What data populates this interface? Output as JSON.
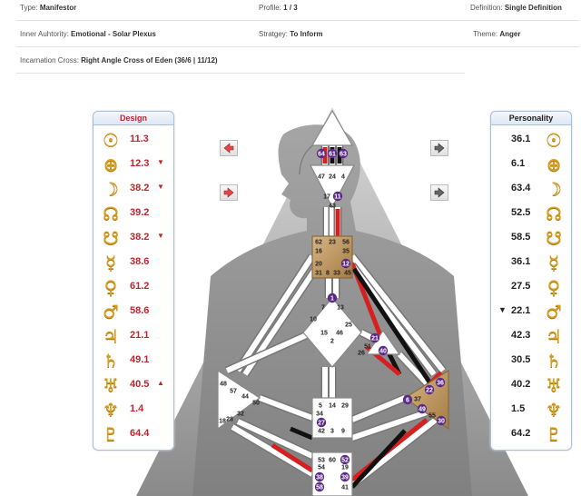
{
  "info": {
    "type_label": "Type:",
    "type_value": "Manifestor",
    "profile_label": "Profile:",
    "profile_value": "1 / 3",
    "definition_label": "Definition:",
    "definition_value": "Single Definition",
    "authority_label": "Inner Auhtority:",
    "authority_value": "Emotional - Solar Plexus",
    "strategy_label": "Stratgey:",
    "strategy_value": "To Inform",
    "theme_label": "Theme:",
    "theme_value": "Anger",
    "cross_label": "Incarnation Cross:",
    "cross_value": "Right Angle Cross of Eden (36/6 | 11/12)"
  },
  "design": {
    "title": "Design",
    "rows": [
      {
        "icon": "sun-icon",
        "glyph": "☉",
        "value": "11.3",
        "mark": ""
      },
      {
        "icon": "earth-icon",
        "glyph": "⊕",
        "value": "12.3",
        "mark": "▼"
      },
      {
        "icon": "moon-icon",
        "glyph": "☽",
        "value": "38.2",
        "mark": "▼"
      },
      {
        "icon": "north-node-icon",
        "glyph": "☊",
        "value": "39.2",
        "mark": ""
      },
      {
        "icon": "south-node-icon",
        "glyph": "☋",
        "value": "38.2",
        "mark": "▼"
      },
      {
        "icon": "mercury-icon",
        "glyph": "☿",
        "value": "38.6",
        "mark": ""
      },
      {
        "icon": "venus-icon",
        "glyph": "♀",
        "value": "61.2",
        "mark": ""
      },
      {
        "icon": "mars-icon",
        "glyph": "♂",
        "value": "58.6",
        "mark": ""
      },
      {
        "icon": "jupiter-icon",
        "glyph": "♃",
        "value": "21.1",
        "mark": ""
      },
      {
        "icon": "saturn-icon",
        "glyph": "♄",
        "value": "49.1",
        "mark": ""
      },
      {
        "icon": "uranus-icon",
        "glyph": "♅",
        "value": "40.5",
        "mark": "▲"
      },
      {
        "icon": "neptune-icon",
        "glyph": "♆",
        "value": "1.4",
        "mark": ""
      },
      {
        "icon": "pluto-icon",
        "glyph": "♇",
        "value": "64.4",
        "mark": ""
      }
    ]
  },
  "personality": {
    "title": "Personality",
    "rows": [
      {
        "icon": "sun-icon",
        "glyph": "☉",
        "value": "36.1",
        "mark": ""
      },
      {
        "icon": "earth-icon",
        "glyph": "⊕",
        "value": "6.1",
        "mark": ""
      },
      {
        "icon": "moon-icon",
        "glyph": "☽",
        "value": "63.4",
        "mark": ""
      },
      {
        "icon": "north-node-icon",
        "glyph": "☊",
        "value": "52.5",
        "mark": ""
      },
      {
        "icon": "south-node-icon",
        "glyph": "☋",
        "value": "58.5",
        "mark": ""
      },
      {
        "icon": "mercury-icon",
        "glyph": "☿",
        "value": "36.1",
        "mark": ""
      },
      {
        "icon": "venus-icon",
        "glyph": "♀",
        "value": "27.5",
        "mark": ""
      },
      {
        "icon": "mars-icon",
        "glyph": "♂",
        "value": "22.1",
        "mark": "▼"
      },
      {
        "icon": "jupiter-icon",
        "glyph": "♃",
        "value": "42.3",
        "mark": ""
      },
      {
        "icon": "saturn-icon",
        "glyph": "♄",
        "value": "30.5",
        "mark": ""
      },
      {
        "icon": "uranus-icon",
        "glyph": "♅",
        "value": "40.2",
        "mark": ""
      },
      {
        "icon": "neptune-icon",
        "glyph": "♆",
        "value": "1.5",
        "mark": ""
      },
      {
        "icon": "pluto-icon",
        "glyph": "♇",
        "value": "64.2",
        "mark": ""
      }
    ]
  },
  "navigation": {
    "left_icons": [
      "arrow-left-red-icon",
      "arrow-right-red-icon"
    ],
    "right_icons": [
      "arrow-right-gray-icon",
      "arrow-right-gray-icon"
    ]
  },
  "bodygraph": {
    "head_gates": [
      "64",
      "61",
      "63"
    ],
    "ajna_gates": [
      "47",
      "24",
      "4",
      "17",
      "11",
      "43"
    ],
    "throat_gates": [
      "62",
      "23",
      "56",
      "16",
      "35",
      "20",
      "12",
      "31",
      "8",
      "33",
      "45"
    ],
    "g_gates": [
      "1",
      "7",
      "13",
      "10",
      "25",
      "15",
      "46",
      "2"
    ],
    "ego_gates": [
      "21",
      "51",
      "26",
      "40"
    ],
    "spleen_gates": [
      "48",
      "57",
      "44",
      "50",
      "32",
      "28",
      "18"
    ],
    "sacral_gates": [
      "5",
      "14",
      "29",
      "34",
      "27",
      "42",
      "3",
      "9"
    ],
    "solar_gates": [
      "36",
      "22",
      "37",
      "6",
      "49",
      "55",
      "30"
    ],
    "root_gates": [
      "53",
      "60",
      "52",
      "54",
      "19",
      "38",
      "39",
      "58",
      "41"
    ],
    "highlighted_gates": [
      "64",
      "61",
      "63",
      "11",
      "12",
      "1",
      "21",
      "40",
      "36",
      "22",
      "6",
      "49",
      "30",
      "27",
      "52",
      "38",
      "39",
      "58"
    ],
    "colors": {
      "defined_center": "#c9a06a",
      "undefined_center": "#ffffff",
      "design_channel": "#d62020",
      "personality_channel": "#111111",
      "gate_circle": "#5b2a86",
      "body_silhouette": "#8c8c8c"
    }
  }
}
